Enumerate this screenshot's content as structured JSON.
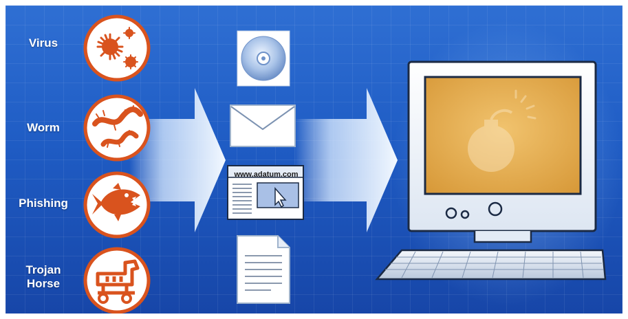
{
  "threats": [
    {
      "label_lines": [
        "Virus"
      ],
      "icon": "virus-icon"
    },
    {
      "label_lines": [
        "Worm"
      ],
      "icon": "worm-icon"
    },
    {
      "label_lines": [
        "Phishing"
      ],
      "icon": "piranha-fish-icon"
    },
    {
      "label_lines": [
        "Trojan",
        "Horse"
      ],
      "icon": "trojan-horse-icon"
    }
  ],
  "vectors": [
    {
      "icon": "cd-disc-icon"
    },
    {
      "icon": "email-envelope-icon"
    },
    {
      "icon": "website-window-icon",
      "url_text": "www.adatum.com"
    },
    {
      "icon": "document-file-icon"
    }
  ],
  "target": {
    "icon": "computer-monitor-icon",
    "screen_icon": "bomb-icon"
  },
  "colors": {
    "background": "#1f5cc4",
    "threat_orange": "#d9531e",
    "circle_fill": "#ffffff",
    "arrow_light": "#e8f3ff",
    "screen_orange": "#e9b24e"
  }
}
